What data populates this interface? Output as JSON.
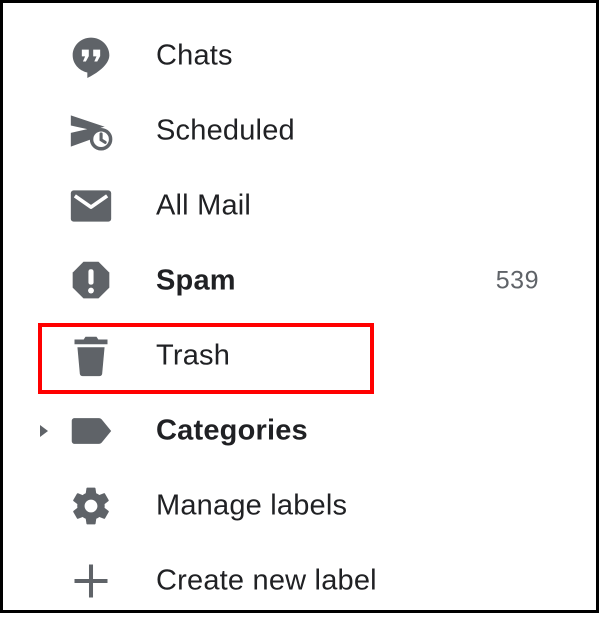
{
  "nav": {
    "items": [
      {
        "label": "Chats",
        "icon": "chat-bubble-icon",
        "bold": false
      },
      {
        "label": "Scheduled",
        "icon": "scheduled-send-icon",
        "bold": false
      },
      {
        "label": "All Mail",
        "icon": "envelope-icon",
        "bold": false
      },
      {
        "label": "Spam",
        "icon": "spam-report-icon",
        "bold": true,
        "count": "539"
      },
      {
        "label": "Trash",
        "icon": "trash-icon",
        "bold": false,
        "highlighted": true
      },
      {
        "label": "Categories",
        "icon": "label-tag-icon",
        "bold": true,
        "expandable": true
      },
      {
        "label": "Manage labels",
        "icon": "gear-icon",
        "bold": false
      },
      {
        "label": "Create new label",
        "icon": "plus-icon",
        "bold": false
      }
    ]
  },
  "colors": {
    "icon": "#5f6368",
    "text": "#202124",
    "count": "#5f6368",
    "highlight_border": "#ff0000",
    "frame_border": "#000000"
  }
}
